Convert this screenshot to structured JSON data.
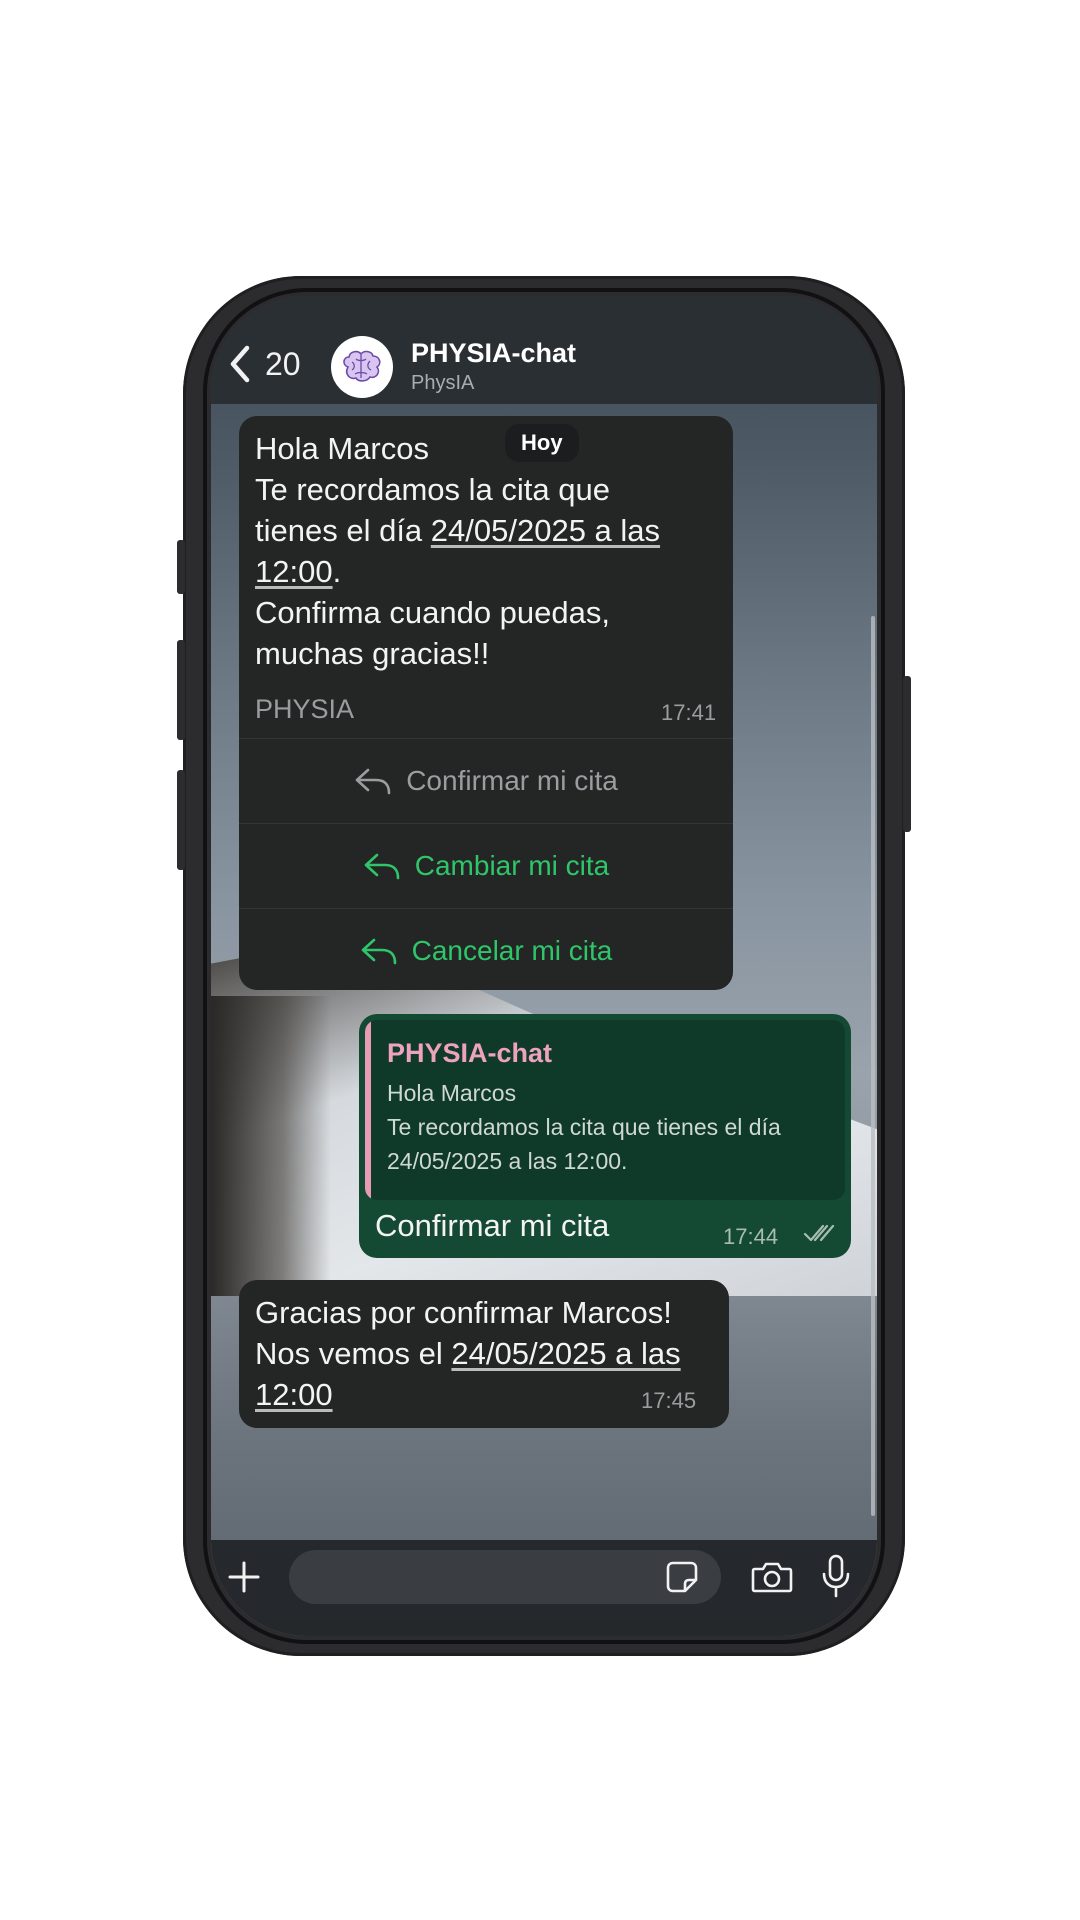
{
  "header": {
    "back_count": "20",
    "title": "PHYSIA-chat",
    "subtitle": "PhysIA"
  },
  "day_chip": "Hoy",
  "message1": {
    "line1": "Hola Marcos",
    "line2": "Te recordamos la cita que",
    "line3_prefix": "tienes el día ",
    "line3_link": "24/05/2025 a las",
    "line4_link": "12:00",
    "line4_suffix": ".",
    "line5": "Confirma cuando puedas,",
    "line6": "muchas gracias!!",
    "signature": "PHYSIA",
    "time": "17:41",
    "actions": [
      {
        "label": "Confirmar mi cita",
        "enabled": false
      },
      {
        "label": "Cambiar mi cita",
        "enabled": true
      },
      {
        "label": "Cancelar mi cita",
        "enabled": true
      }
    ]
  },
  "message2": {
    "quote_author": "PHYSIA-chat",
    "quote_line1": "Hola Marcos",
    "quote_line2": "Te recordamos la cita que tienes el día",
    "quote_line3": "24/05/2025 a las 12:00.",
    "text": "Confirmar mi cita",
    "time": "17:44"
  },
  "message3": {
    "line1": "Gracias por confirmar Marcos!",
    "line2_prefix": "Nos vemos el ",
    "line2_link": "24/05/2025 a las",
    "line3_link": "12:00",
    "time": "17:45"
  },
  "input": {
    "placeholder": ""
  },
  "colors": {
    "accent_green": "#2fc66a",
    "outgoing_bubble": "#144a33",
    "incoming_bubble": "#242626",
    "quote_author": "#eda2bd"
  },
  "icons": [
    "chevron-left-icon",
    "brain-icon",
    "reply-icon",
    "double-check-icon",
    "plus-icon",
    "sticker-icon",
    "camera-icon",
    "microphone-icon"
  ]
}
